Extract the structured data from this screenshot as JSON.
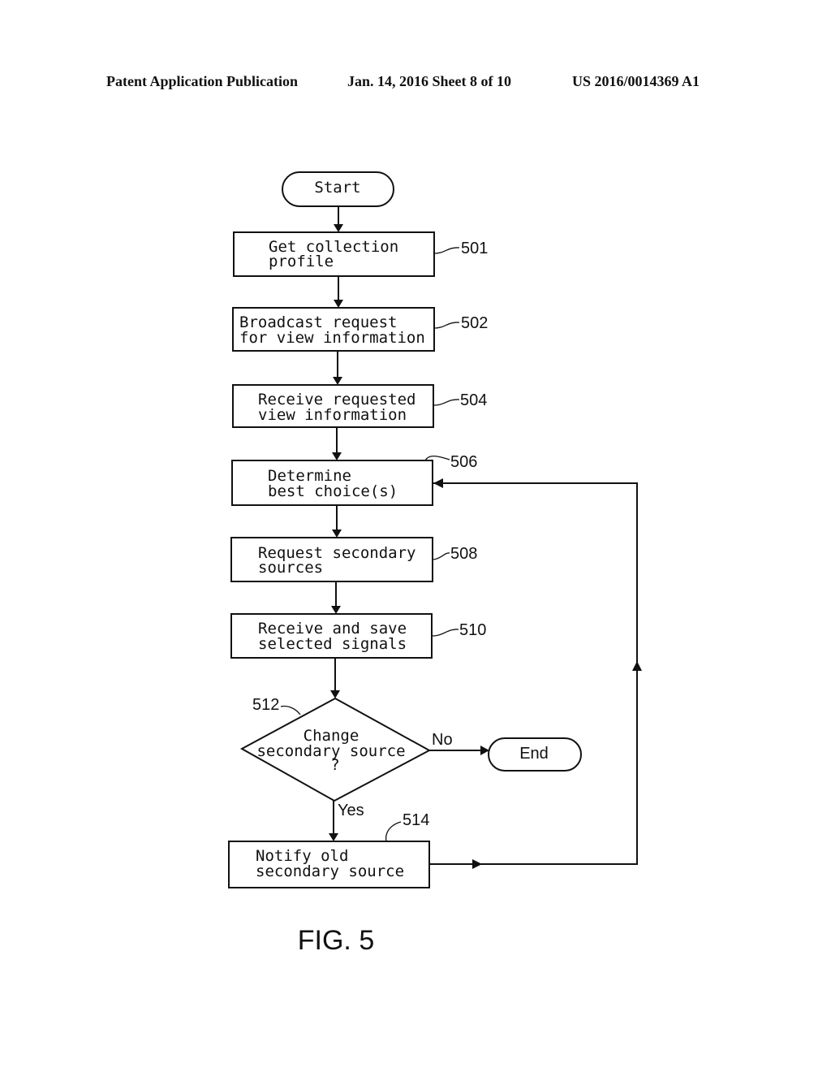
{
  "header": {
    "publication": "Patent Application Publication",
    "date_sheet": "Jan. 14, 2016  Sheet 8 of 10",
    "patent_number": "US 2016/0014369 A1"
  },
  "flowchart": {
    "start": "Start",
    "end": "End",
    "steps": [
      {
        "ref": "501",
        "lines": [
          "Get collection",
          "profile"
        ]
      },
      {
        "ref": "502",
        "lines": [
          "Broadcast request",
          "for view information"
        ]
      },
      {
        "ref": "504",
        "lines": [
          "Receive requested",
          "view information"
        ]
      },
      {
        "ref": "506",
        "lines": [
          "Determine",
          "best choice(s)"
        ]
      },
      {
        "ref": "508",
        "lines": [
          "Request secondary",
          "sources"
        ]
      },
      {
        "ref": "510",
        "lines": [
          "Receive and save",
          "selected signals"
        ]
      },
      {
        "ref": "514",
        "lines": [
          "Notify old",
          "secondary source"
        ]
      }
    ],
    "decision": {
      "ref": "512",
      "lines": [
        "Change",
        "secondary source",
        "?"
      ],
      "yes_label": "Yes",
      "no_label": "No"
    }
  },
  "figure_label": "FIG. 5"
}
